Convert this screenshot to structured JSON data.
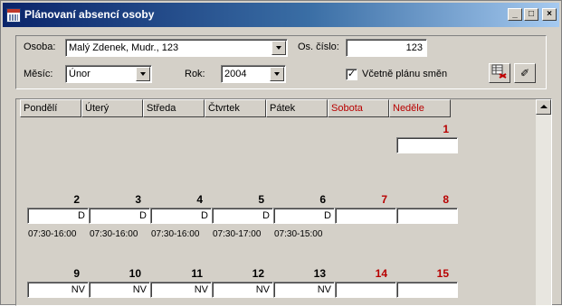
{
  "window": {
    "title": "Plánovaní absencí osoby",
    "min_glyph": "_",
    "max_glyph": "□",
    "close_glyph": "×"
  },
  "form": {
    "osoba_label": "Osoba:",
    "osoba_value": "Malý Zdenek, Mudr., 123",
    "os_cislo_label": "Os. číslo:",
    "os_cislo_value": "123",
    "mesic_label": "Měsíc:",
    "mesic_value": "Únor",
    "rok_label": "Rok:",
    "rok_value": "2004",
    "checkbox_label": "Včetně plánu směn",
    "checkbox_checked": true,
    "checkbox_glyph": "✓",
    "erase_glyph": "✐"
  },
  "grid": {
    "headers": [
      {
        "label": "Pondělí",
        "weekend": false
      },
      {
        "label": "Úterý",
        "weekend": false
      },
      {
        "label": "Středa",
        "weekend": false
      },
      {
        "label": "Čtvrtek",
        "weekend": false
      },
      {
        "label": "Pátek",
        "weekend": false
      },
      {
        "label": "Sobota",
        "weekend": true
      },
      {
        "label": "Neděle",
        "weekend": true
      }
    ],
    "weeks": [
      [
        null,
        null,
        null,
        null,
        null,
        null,
        {
          "day": "1",
          "value": "",
          "time": "",
          "weekend": true
        }
      ],
      [
        {
          "day": "2",
          "value": "D",
          "time": "07:30-16:00",
          "weekend": false
        },
        {
          "day": "3",
          "value": "D",
          "time": "07:30-16:00",
          "weekend": false
        },
        {
          "day": "4",
          "value": "D",
          "time": "07:30-16:00",
          "weekend": false
        },
        {
          "day": "5",
          "value": "D",
          "time": "07:30-17:00",
          "weekend": false
        },
        {
          "day": "6",
          "value": "D",
          "time": "07:30-15:00",
          "weekend": false
        },
        {
          "day": "7",
          "value": "",
          "time": "",
          "weekend": true
        },
        {
          "day": "8",
          "value": "",
          "time": "",
          "weekend": true
        }
      ],
      [
        {
          "day": "9",
          "value": "NV",
          "time": "",
          "weekend": false
        },
        {
          "day": "10",
          "value": "NV",
          "time": "",
          "weekend": false
        },
        {
          "day": "11",
          "value": "NV",
          "time": "",
          "weekend": false
        },
        {
          "day": "12",
          "value": "NV",
          "time": "",
          "weekend": false
        },
        {
          "day": "13",
          "value": "NV",
          "time": "",
          "weekend": false
        },
        {
          "day": "14",
          "value": "",
          "time": "",
          "weekend": true
        },
        {
          "day": "15",
          "value": "",
          "time": "",
          "weekend": true
        }
      ]
    ]
  }
}
